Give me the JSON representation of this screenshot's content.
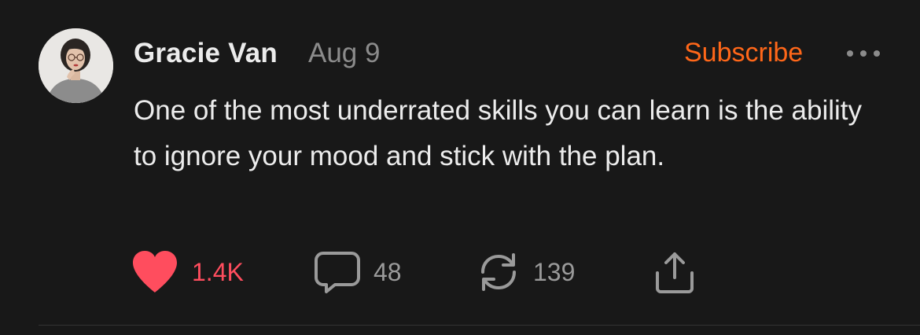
{
  "post": {
    "author": "Gracie Van",
    "date": "Aug 9",
    "subscribe_label": "Subscribe",
    "text": "One of the most underrated skills you can learn is the ability to ignore your mood and stick with the plan.",
    "actions": {
      "likes": "1.4K",
      "comments": "48",
      "restacks": "139"
    },
    "icons": {
      "avatar": "author-avatar",
      "more": "more-horizontal-icon",
      "like": "heart-icon",
      "comment": "comment-bubble-icon",
      "restack": "restack-icon",
      "share": "share-icon"
    }
  },
  "colors": {
    "background": "#181818",
    "text": "#ececec",
    "muted": "#8b8b8b",
    "accent": "#ff6719",
    "like": "#ff4d5e"
  }
}
